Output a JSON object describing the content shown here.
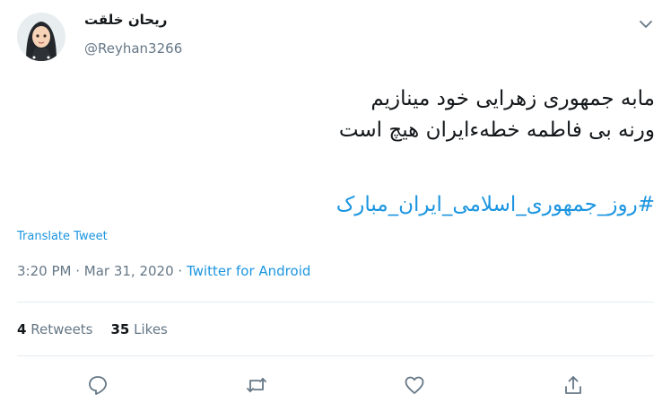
{
  "user": {
    "display_name": "ریحان خلقت",
    "handle": "@Reyhan3266",
    "avatar_icon": "girl-hijab-cartoon-avatar"
  },
  "tweet": {
    "lines": [
      "مابه جمهوری زهرایی خود مینازیم",
      "ورنه بی فاطمه خطهءایران هیچ است"
    ],
    "hashtag": "#روز_جمهوری_اسلامی_ایران_مبارک",
    "translate_label": "Translate Tweet"
  },
  "meta": {
    "time": "3:20 PM",
    "separator": " · ",
    "date": "Mar 31, 2020",
    "source": "Twitter for Android"
  },
  "stats": {
    "retweets_count": "4",
    "retweets_label": "Retweets",
    "likes_count": "35",
    "likes_label": "Likes"
  },
  "icons": {
    "reply": "reply-icon",
    "retweet": "retweet-icon",
    "like": "heart-icon",
    "share": "share-icon",
    "menu": "chevron-down-icon"
  },
  "colors": {
    "link": "#1b95e0",
    "muted": "#657786",
    "text": "#14171a",
    "divider": "#e6ecf0"
  }
}
